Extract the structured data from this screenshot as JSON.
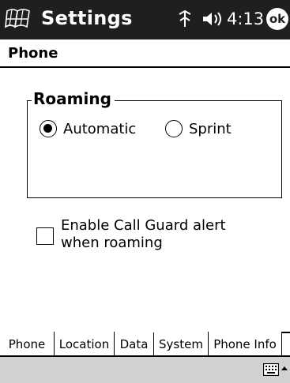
{
  "titlebar": {
    "title": "Settings",
    "time": "4:13",
    "ok_label": "ok",
    "icons": [
      "start-flag-icon",
      "connectivity-icon",
      "speaker-icon"
    ]
  },
  "page": {
    "heading": "Phone"
  },
  "roaming": {
    "group_title": "Roaming",
    "options": [
      {
        "label": "Automatic",
        "checked": true
      },
      {
        "label": "Sprint",
        "checked": false
      }
    ]
  },
  "call_guard": {
    "label": "Enable Call Guard alert when roaming",
    "checked": false
  },
  "tabs": [
    {
      "label": "Phone",
      "selected": false
    },
    {
      "label": "Location",
      "selected": false
    },
    {
      "label": "Data",
      "selected": false
    },
    {
      "label": "System",
      "selected": true
    },
    {
      "label": "Phone Info",
      "selected": false
    }
  ],
  "bottombar": {
    "icons": [
      "keyboard-icon",
      "sip-arrow-icon"
    ]
  },
  "colors": {
    "titlebar_bg": "#1f1f1f",
    "bottombar_bg": "#d2d2d2"
  }
}
